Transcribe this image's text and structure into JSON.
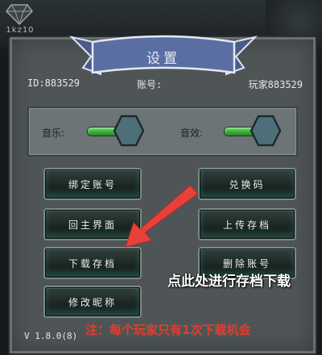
{
  "header": {
    "diamond_count": "1kz10"
  },
  "dialog": {
    "title": "设置",
    "id_text": "ID:883529",
    "account_label": "账号:",
    "player_name": "玩家883529"
  },
  "audio": {
    "music_label": "音乐:",
    "sfx_label": "音效:",
    "music_level": 1.0,
    "sfx_level": 1.0
  },
  "buttons": {
    "bind_account": "绑定账号",
    "redeem_code": "兑换码",
    "main_menu": "回主界面",
    "upload_save": "上传存档",
    "download_save": "下载存档",
    "delete_account": "删除账号",
    "change_nickname": "修改昵称"
  },
  "footer": {
    "version": "V 1.8.0(8)"
  },
  "annotation": {
    "callout": "点此处进行存档下载",
    "notice": "注：每个玩家只有1次下载机会",
    "arrow_color": "#e8413a"
  },
  "colors": {
    "accent_green": "#3cc33c",
    "notice_red": "#e53c2e",
    "panel_gray": "#4f5556"
  }
}
